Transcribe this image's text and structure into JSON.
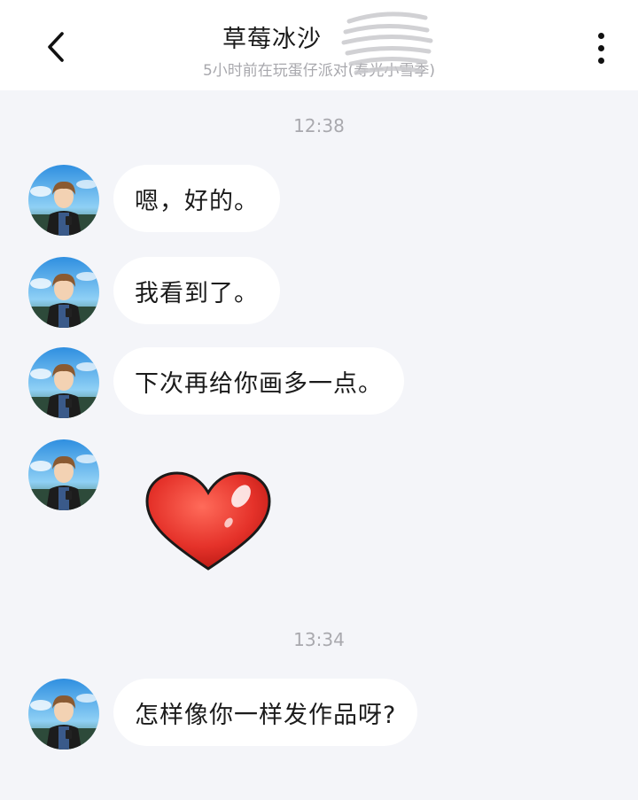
{
  "header": {
    "title": "草莓冰沙",
    "status": "5小时前在玩蛋仔派对(寿光小雪季)"
  },
  "timestamps": [
    "12:38",
    "13:34"
  ],
  "messages": [
    {
      "text": "嗯，好的。"
    },
    {
      "text": "我看到了。"
    },
    {
      "text": "下次再给你画多一点。"
    },
    {
      "sticker": "heart-icon"
    },
    {
      "text": "怎样像你一样发作品呀?"
    }
  ],
  "colors": {
    "background": "#f4f5f9",
    "bubble": "#ffffff",
    "heart": "#e5322a"
  }
}
